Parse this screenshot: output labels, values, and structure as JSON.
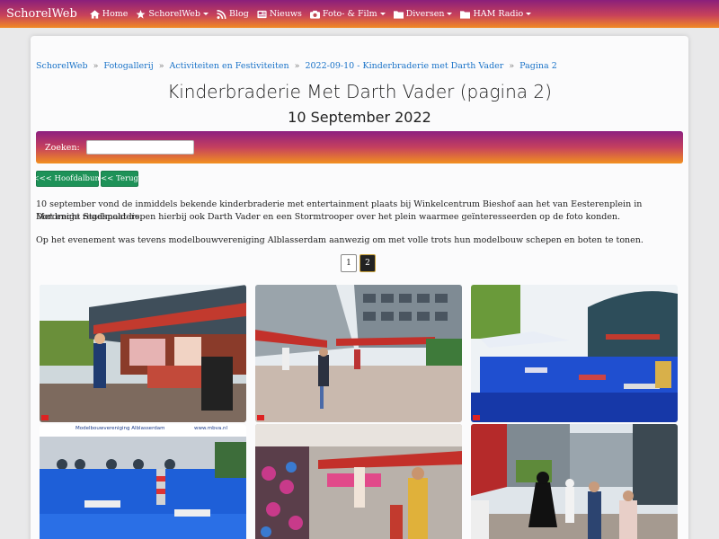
{
  "nav": {
    "brand": "SchorelWeb",
    "items": [
      {
        "label": "Home",
        "icon": "home-icon",
        "dropdown": false
      },
      {
        "label": "SchorelWeb",
        "icon": "star-icon",
        "dropdown": true
      },
      {
        "label": "Blog",
        "icon": "rss-icon",
        "dropdown": false
      },
      {
        "label": "Nieuws",
        "icon": "newspaper-icon",
        "dropdown": false
      },
      {
        "label": "Foto- & Film",
        "icon": "camera-icon",
        "dropdown": true
      },
      {
        "label": "Diversen",
        "icon": "folder-icon",
        "dropdown": true
      },
      {
        "label": "HAM Radio",
        "icon": "folder-icon",
        "dropdown": true
      }
    ]
  },
  "breadcrumb": [
    "SchorelWeb",
    "Fotogallerij",
    "Activiteiten en Festiviteiten",
    "2022-09-10 - Kinderbraderie met Darth Vader",
    "Pagina 2"
  ],
  "page": {
    "title": "Kinderbraderie Met Darth Vader (pagina 2)",
    "subtitle": "10 September 2022"
  },
  "search": {
    "label": "Zoeken:",
    "value": ""
  },
  "buttons": {
    "main_album": "<<< Hoofdalbum",
    "back": "<< Terug"
  },
  "description": {
    "line1": "10 september vond de inmiddels bekende kinderbraderie met entertainment plaats bij Winkelcentrum Bieshof aan het van Eesterenplein in Dordrecht Stadspolders.",
    "line2": "Met enige regelmaat liepen hierbij ook Darth Vader en een Stormtrooper over het plein waarmee geïnteresseerden op de foto konden.",
    "line3": "Op het evenement was tevens modelbouwvereniging Alblasserdam aanwezig om met volle trots hun modelbouw schepen en boten te tonen."
  },
  "pagination": {
    "pages": [
      "1",
      "2"
    ],
    "active": "2"
  },
  "gallery": {
    "photos": [
      {
        "id": "photo-1",
        "theme": "market-stalls"
      },
      {
        "id": "photo-2",
        "theme": "shopping-street"
      },
      {
        "id": "photo-3",
        "theme": "model-boat-pool"
      },
      {
        "id": "photo-4",
        "theme": "model-club-pool",
        "banner": "Modelbouwvereniging Alblasserdam",
        "banner_side": "www.mbva.nl"
      },
      {
        "id": "photo-5",
        "theme": "toy-stall"
      },
      {
        "id": "photo-6",
        "theme": "darth-vader-crowd"
      }
    ]
  },
  "colors": {
    "accent_purple": "#8a1f7b",
    "accent_orange": "#f18a25",
    "link": "#1a73c8",
    "button_green": "#1e9258"
  }
}
